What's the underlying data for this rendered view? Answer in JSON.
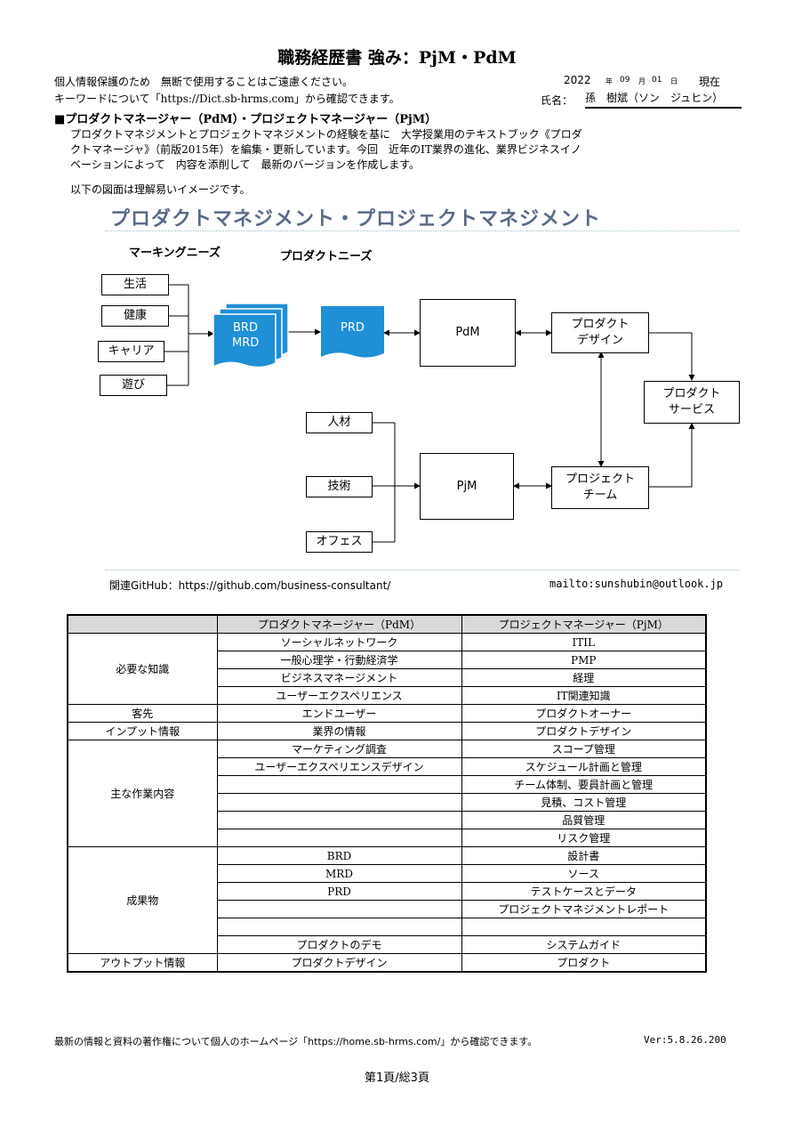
{
  "header": {
    "title": "職務経歴書 強み：PjM・PdM",
    "privacy_note": "個人情報保護のため　無断で使用することはご遠慮ください。",
    "keyword_note": "キーワードについて「https://Dict.sb-hrms.com」から確認できます。",
    "date_year": "2022",
    "date_year_unit": "年",
    "date_month": "09",
    "date_month_unit": "月",
    "date_day": "01",
    "date_day_unit": "日",
    "date_suffix": "現在",
    "name_label": "氏名：",
    "name_value": "孫　樹斌（ソン　ジュヒン）"
  },
  "section": {
    "heading": "■プロダクトマネージャー（PdM）・プロジェクトマネージャー（PjM）",
    "body_line1": "プロダクトマネジメントとプロジェクトマネジメントの経験を基に　大学授業用のテキストブック《プロダ",
    "body_line2": "クトマネージャ》（前版2015年）を編集・更新しています。今回　近年のIT業界の進化、業界ビジネスイノ",
    "body_line3": "ベーションによって　内容を添削して　最新のバージョンを作成します。",
    "figure_note": "以下の図面は理解易いイメージです。"
  },
  "diagram": {
    "title": "プロダクトマネジメント・プロジェクトマネジメント",
    "label_marketing": "マーキングニーズ",
    "label_product_needs": "プロダクトニーズ",
    "needs": [
      "生活",
      "健康",
      "キャリア",
      "遊び"
    ],
    "doc_brd": "BRD",
    "doc_mrd": "MRD",
    "doc_prd": "PRD",
    "pdm": "PdM",
    "pjm": "PjM",
    "product_design_1": "プロダクト",
    "product_design_2": "デザイン",
    "product_service_1": "プロダクト",
    "product_service_2": "サービス",
    "project_team_1": "プロジェクト",
    "project_team_2": "チーム",
    "resources": [
      "人材",
      "技術",
      "オフェス"
    ],
    "github": "関連GitHub：https://github.com/business-consultant/",
    "mail": "mailto:sunshubin@outlook.jp",
    "doc_color": "#1f8fd6"
  },
  "table": {
    "head": [
      "",
      "プロダクトマネージャー（PdM）",
      "プロジェクトマネージャー（PjM）"
    ],
    "cat_knowledge": "必要な知識",
    "cat_customer": "客先",
    "cat_input": "インプット情報",
    "cat_work": "主な作業内容",
    "cat_deliverable": "成果物",
    "cat_output": "アウトプット情報",
    "knowledge": [
      [
        "ソーシャルネットワーク",
        "ITIL"
      ],
      [
        "一般心理学・行動経済学",
        "PMP"
      ],
      [
        "ビジネスマネージメント",
        "経理"
      ],
      [
        "ユーザーエクスペリエンス",
        "IT関連知識"
      ]
    ],
    "customer": [
      "エンドユーザー",
      "プロダクトオーナー"
    ],
    "input": [
      "業界の情報",
      "プロダクトデザイン"
    ],
    "work": [
      [
        "マーケティング調査",
        "スコープ管理"
      ],
      [
        "ユーザーエクスペリエンスデザイン",
        "スケジュール計画と管理"
      ],
      [
        "",
        "チーム体制、要員計画と管理"
      ],
      [
        "",
        "見積、コスト管理"
      ],
      [
        "",
        "品質管理"
      ],
      [
        "",
        "リスク管理"
      ]
    ],
    "deliverable": [
      [
        "BRD",
        "設計書"
      ],
      [
        "MRD",
        "ソース"
      ],
      [
        "PRD",
        "テストケースとデータ"
      ],
      [
        "",
        "プロジェクトマネジメントレポート"
      ],
      [
        "",
        ""
      ],
      [
        "プロダクトのデモ",
        "システムガイド"
      ]
    ],
    "output": [
      "プロダクトデザイン",
      "プロダクト"
    ]
  },
  "footer": {
    "note": "最新の情報と資料の著作権について個人のホームページ「https://home.sb-hrms.com/」から確認できます。",
    "version": "Ver:5.8.26.200",
    "page": "第1頁/総3頁"
  }
}
